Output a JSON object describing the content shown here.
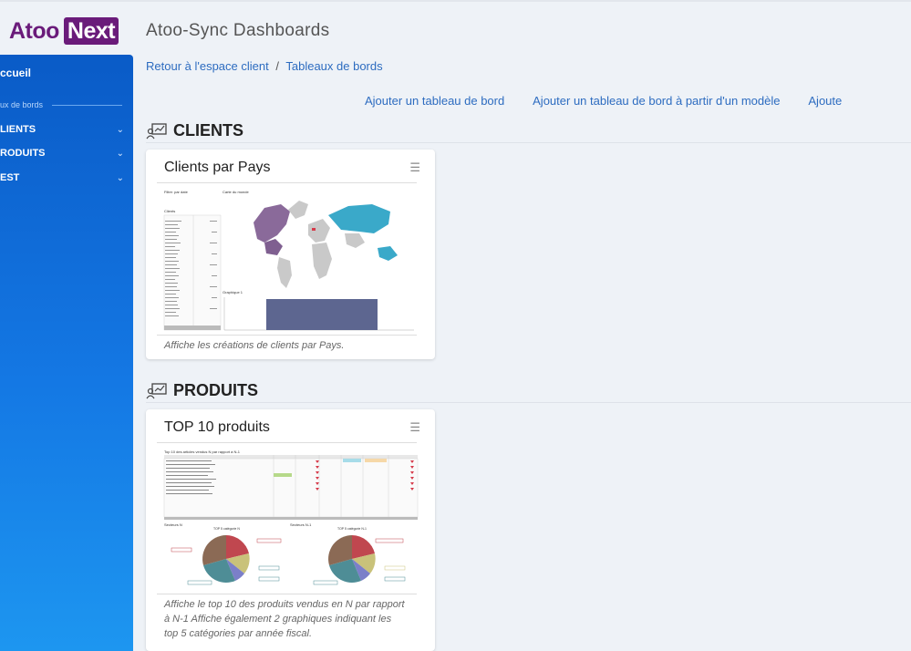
{
  "header": {
    "logo_a": "Atoo",
    "logo_b": "Next",
    "app_title": "Atoo-Sync Dashboards"
  },
  "sidebar": {
    "accueil": "ccueil",
    "section": "ux de bords",
    "items": [
      {
        "label": "LIENTS"
      },
      {
        "label": "RODUITS"
      },
      {
        "label": "EST"
      }
    ]
  },
  "breadcrumb": {
    "home": "Retour à l'espace client",
    "sep": "/",
    "current": "Tableaux de bords"
  },
  "actions": {
    "add": "Ajouter un tableau de bord",
    "add_from_template": "Ajouter un tableau de bord à partir d'un modèle",
    "more": "Ajoute"
  },
  "sections": [
    {
      "title": "CLIENTS",
      "card": {
        "title": "Clients par Pays",
        "description": "Affiche les créations de clients par Pays.",
        "thumb": {
          "filter_label": "Filtre: par date",
          "map_label": "Carte du monde",
          "table_title": "Clients",
          "chart_label": "Graphique 1"
        }
      }
    },
    {
      "title": "PRODUITS",
      "card": {
        "title": "TOP 10 produits",
        "description": "Affiche le top 10 des produits vendus en N par rapport à N-1 Affiche également 2 graphiques indiquant les top 5 catégories par année fiscal.",
        "thumb": {
          "table_title": "Top 10 des articles vendus N par rapport à N-1",
          "left_label": "Secteurs N",
          "right_label": "Secteurs N-1",
          "left_pie": "TOP 5 catégorie N",
          "right_pie": "TOP 5 catégorie N-1"
        }
      }
    }
  ],
  "icons": {
    "menu": "hamburger-icon",
    "chevron": "chevron-down-icon",
    "section": "dashboard-icon"
  },
  "colors": {
    "brand": "#6a1b7a",
    "sidebar_top": "#0a5bc7",
    "sidebar_bottom": "#1d96f0",
    "link": "#2d6cc0"
  }
}
